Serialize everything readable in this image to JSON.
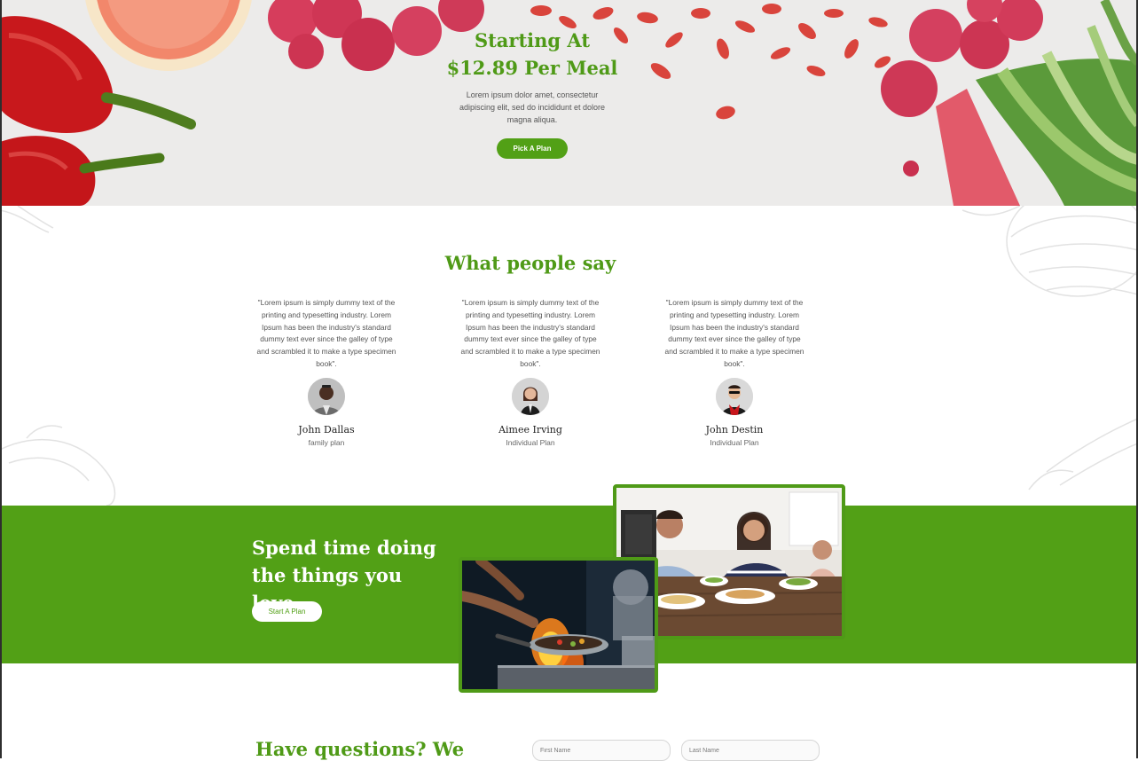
{
  "hero": {
    "title_line1": "Starting At",
    "title_line2": "$12.89 Per Meal",
    "text": "Lorem ipsum dolor amet, consectetur adipiscing elit, sed do incididunt  et dolore magna aliqua.",
    "cta_label": "Pick A Plan"
  },
  "testimonials": {
    "title": "What people say",
    "items": [
      {
        "quote": "\"Lorem ipsum is simply dummy text of the printing and typesetting industry. Lorem Ipsum has been the industry's standard dummy text ever since the galley of type and scrambled it to make a type specimen book\".",
        "name": "John Dallas",
        "plan": "family plan"
      },
      {
        "quote": "\"Lorem ipsum is simply dummy text of the printing and typesetting industry. Lorem Ipsum has been the industry's standard dummy text ever since the galley of type and scrambled it to make a type specimen book\".",
        "name": "Aimee Irving",
        "plan": "Individual Plan"
      },
      {
        "quote": "\"Lorem ipsum is simply dummy text of the printing and typesetting industry. Lorem Ipsum has been the industry's standard dummy text ever since the galley of type and scrambled it to make a type specimen book\".",
        "name": "John Destin",
        "plan": "Individual Plan"
      }
    ]
  },
  "banner": {
    "title": "Spend time doing the things you love.",
    "cta_label": "Start A Plan"
  },
  "contact": {
    "title": "Have questions? We",
    "first_name_placeholder": "First Name",
    "last_name_placeholder": "Last Name"
  },
  "colors": {
    "brand_green": "#52a016",
    "heading_green": "#4f9a17",
    "white": "#ffffff"
  }
}
